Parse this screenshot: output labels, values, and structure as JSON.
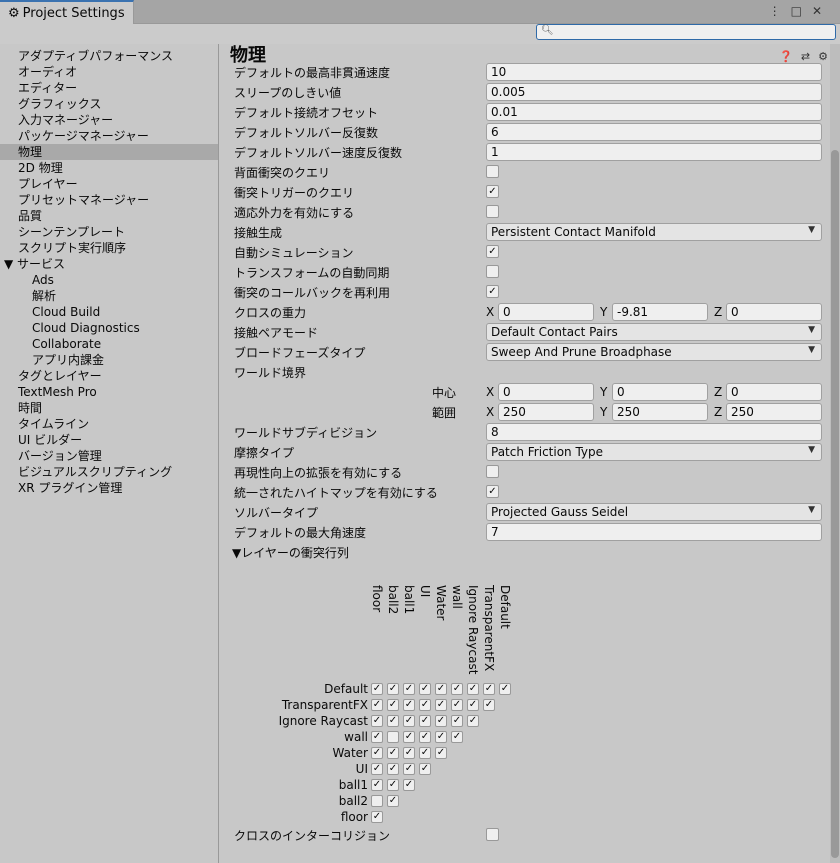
{
  "window": {
    "tab_title": "Project Settings",
    "search": {
      "placeholder": "",
      "value": ""
    }
  },
  "sidebar": {
    "items": [
      {
        "label": "アダプティブパフォーマンス",
        "kind": "top"
      },
      {
        "label": "オーディオ",
        "kind": "top"
      },
      {
        "label": "エディター",
        "kind": "top"
      },
      {
        "label": "グラフィックス",
        "kind": "top"
      },
      {
        "label": "入力マネージャー",
        "kind": "top"
      },
      {
        "label": "パッケージマネージャー",
        "kind": "top"
      },
      {
        "label": "物理",
        "kind": "top",
        "selected": true
      },
      {
        "label": "2D 物理",
        "kind": "top"
      },
      {
        "label": "プレイヤー",
        "kind": "top"
      },
      {
        "label": "プリセットマネージャー",
        "kind": "top"
      },
      {
        "label": "品質",
        "kind": "top"
      },
      {
        "label": "シーンテンプレート",
        "kind": "top"
      },
      {
        "label": "スクリプト実行順序",
        "kind": "top"
      },
      {
        "label": "▼ サービス",
        "kind": "group"
      },
      {
        "label": "Ads",
        "kind": "sub"
      },
      {
        "label": "解析",
        "kind": "sub"
      },
      {
        "label": "Cloud Build",
        "kind": "sub"
      },
      {
        "label": "Cloud Diagnostics",
        "kind": "sub"
      },
      {
        "label": "Collaborate",
        "kind": "sub"
      },
      {
        "label": "アプリ内課金",
        "kind": "sub"
      },
      {
        "label": "タグとレイヤー",
        "kind": "top"
      },
      {
        "label": "TextMesh Pro",
        "kind": "top"
      },
      {
        "label": "時間",
        "kind": "top"
      },
      {
        "label": "タイムライン",
        "kind": "top"
      },
      {
        "label": "UI ビルダー",
        "kind": "top"
      },
      {
        "label": "バージョン管理",
        "kind": "top"
      },
      {
        "label": "ビジュアルスクリプティング",
        "kind": "top"
      },
      {
        "label": "XR プラグイン管理",
        "kind": "top"
      }
    ]
  },
  "main": {
    "title": "物理",
    "rows": [
      {
        "label": "デフォルトの最高非貫通速度",
        "type": "text",
        "value": "10"
      },
      {
        "label": "スリープのしきい値",
        "type": "text",
        "value": "0.005"
      },
      {
        "label": "デフォルト接続オフセット",
        "type": "text",
        "value": "0.01"
      },
      {
        "label": "デフォルトソルバー反復数",
        "type": "text",
        "value": "6"
      },
      {
        "label": "デフォルトソルバー速度反復数",
        "type": "text",
        "value": "1"
      },
      {
        "label": "背面衝突のクエリ",
        "type": "check",
        "checked": false
      },
      {
        "label": "衝突トリガーのクエリ",
        "type": "check",
        "checked": true
      },
      {
        "label": "適応外力を有効にする",
        "type": "check",
        "checked": false
      },
      {
        "label": "接触生成",
        "type": "drop",
        "value": "Persistent Contact Manifold"
      },
      {
        "label": "自動シミュレーション",
        "type": "check",
        "checked": true
      },
      {
        "label": "トランスフォームの自動同期",
        "type": "check",
        "checked": false
      },
      {
        "label": "衝突のコールバックを再利用",
        "type": "check",
        "checked": true
      },
      {
        "label": "クロスの重力",
        "type": "xyz",
        "x": "0",
        "y": "-9.81",
        "z": "0"
      },
      {
        "label": "接触ペアモード",
        "type": "drop",
        "value": "Default Contact Pairs"
      },
      {
        "label": "ブロードフェーズタイプ",
        "type": "drop",
        "value": "Sweep And Prune Broadphase"
      },
      {
        "label": "ワールド境界",
        "type": "none"
      },
      {
        "label": "中心",
        "type": "xyz",
        "indent": true,
        "x": "0",
        "y": "0",
        "z": "0"
      },
      {
        "label": "範囲",
        "type": "xyz",
        "indent": true,
        "x": "250",
        "y": "250",
        "z": "250"
      },
      {
        "label": "ワールドサブディビジョン",
        "type": "text",
        "value": "8"
      },
      {
        "label": "摩擦タイプ",
        "type": "drop",
        "value": "Patch Friction Type"
      },
      {
        "label": "再現性向上の拡張を有効にする",
        "type": "check",
        "checked": false
      },
      {
        "label": "統一されたハイトマップを有効にする",
        "type": "check",
        "checked": true
      },
      {
        "label": "ソルバータイプ",
        "type": "drop",
        "value": "Projected Gauss Seidel"
      },
      {
        "label": "デフォルトの最大角速度",
        "type": "text",
        "value": "7"
      }
    ],
    "matrix": {
      "title": "▼レイヤーの衝突行列",
      "columns": [
        "floor",
        "ball2",
        "ball1",
        "UI",
        "Water",
        "wall",
        "Ignore Raycast",
        "TransparentFX",
        "Default"
      ],
      "rows": [
        {
          "name": "Default",
          "checks": [
            true,
            true,
            true,
            true,
            true,
            true,
            true,
            true,
            true
          ]
        },
        {
          "name": "TransparentFX",
          "checks": [
            true,
            true,
            true,
            true,
            true,
            true,
            true,
            true
          ]
        },
        {
          "name": "Ignore Raycast",
          "checks": [
            true,
            true,
            true,
            true,
            true,
            true,
            true
          ]
        },
        {
          "name": "wall",
          "checks": [
            true,
            false,
            true,
            true,
            true,
            true
          ]
        },
        {
          "name": "Water",
          "checks": [
            true,
            true,
            true,
            true,
            true
          ]
        },
        {
          "name": "UI",
          "checks": [
            true,
            true,
            true,
            true
          ]
        },
        {
          "name": "ball1",
          "checks": [
            true,
            true,
            true
          ]
        },
        {
          "name": "ball2",
          "checks": [
            false,
            true
          ]
        },
        {
          "name": "floor",
          "checks": [
            true
          ]
        }
      ]
    },
    "cloth_intercollision": {
      "label": "クロスのインターコリジョン",
      "checked": false
    }
  }
}
